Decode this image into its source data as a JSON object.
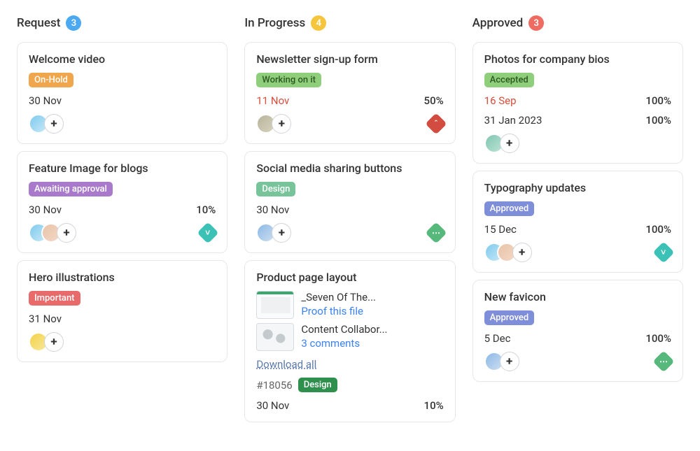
{
  "columns": [
    {
      "title": "Request",
      "count": "3",
      "badgeClass": "badge-blue",
      "cards": [
        {
          "title": "Welcome video",
          "tag": {
            "text": "On-Hold",
            "class": "tag-onhold"
          },
          "date": "30 Nov",
          "overdue": false,
          "progress": "",
          "assignees": [
            {
              "bg": "linear-gradient(135deg,#7ecaed,#c9e9f8)"
            }
          ],
          "priority": null
        },
        {
          "title": "Feature Image for blogs",
          "tag": {
            "text": "Awaiting approval",
            "class": "tag-awaiting"
          },
          "date": "30 Nov",
          "overdue": false,
          "progress": "10%",
          "assignees": [
            {
              "bg": "linear-gradient(135deg,#7ecaed,#c9e9f8)"
            },
            {
              "bg": "linear-gradient(135deg,#e9c3a8,#f3d8c6)"
            }
          ],
          "priority": {
            "class": "pri-teal",
            "glyph": "˅"
          }
        },
        {
          "title": "Hero illustrations",
          "tag": {
            "text": "Important",
            "class": "tag-important"
          },
          "date": "31 Nov",
          "overdue": false,
          "progress": "",
          "assignees": [
            {
              "bg": "linear-gradient(135deg,#f4d24a,#f8e79a)"
            }
          ],
          "priority": null
        }
      ]
    },
    {
      "title": "In Progress",
      "count": "4",
      "badgeClass": "badge-yellow",
      "cards": [
        {
          "title": "Newsletter sign-up form",
          "tag": {
            "text": "Working on it",
            "class": "tag-working"
          },
          "date": "11 Nov",
          "overdue": true,
          "progress": "50%",
          "assignees": [
            {
              "bg": "linear-gradient(135deg,#b8b49a,#d6d3bf)"
            }
          ],
          "priority": {
            "class": "pri-red",
            "glyph": "ˆ"
          }
        },
        {
          "title": "Social media sharing buttons",
          "tag": {
            "text": "Design",
            "class": "tag-design"
          },
          "date": "30 Nov",
          "overdue": false,
          "progress": "",
          "assignees": [
            {
              "bg": "linear-gradient(135deg,#8db8e6,#cddff1)"
            }
          ],
          "priority": {
            "class": "pri-green",
            "glyph": "⋯"
          }
        },
        {
          "title": "Product page layout",
          "attachments": [
            {
              "name": "_Seven Of The...",
              "action": "Proof this file",
              "thumbClass": "thumb"
            },
            {
              "name": "Content Collabor...",
              "action": "3 comments",
              "thumbClass": "thumb2"
            }
          ],
          "download": "Download all",
          "ref": "#18056",
          "refTag": {
            "text": "Design",
            "class": "tag-design-dark"
          },
          "date": "30 Nov",
          "overdue": false,
          "progress": "10%",
          "assignees": [],
          "priority": null
        }
      ]
    },
    {
      "title": "Approved",
      "count": "3",
      "badgeClass": "badge-red",
      "cards": [
        {
          "title": "Photos for company bios",
          "tag": {
            "text": "Accepted",
            "class": "tag-accepted"
          },
          "date": "16 Sep",
          "overdue": true,
          "date2": "31 Jan 2023",
          "progress": "100%",
          "assignees": [
            {
              "bg": "linear-gradient(135deg,#7fc6b0,#bde3d6)"
            }
          ],
          "priority": null
        },
        {
          "title": "Typography updates",
          "tag": {
            "text": "Approved",
            "class": "tag-approved"
          },
          "date": "15 Dec",
          "overdue": false,
          "progress": "100%",
          "assignees": [
            {
              "bg": "linear-gradient(135deg,#7ecaed,#c9e9f8)"
            },
            {
              "bg": "linear-gradient(135deg,#e9c3a8,#f3d8c6)"
            }
          ],
          "priority": {
            "class": "pri-teal",
            "glyph": "˅"
          }
        },
        {
          "title": "New favicon",
          "tag": {
            "text": "Approved",
            "class": "tag-approved"
          },
          "date": "5 Dec",
          "overdue": false,
          "progress": "100%",
          "assignees": [
            {
              "bg": "linear-gradient(135deg,#8db8e6,#cddff1)"
            }
          ],
          "priority": {
            "class": "pri-green2",
            "glyph": "⋯"
          }
        }
      ]
    }
  ],
  "ui": {
    "addAssigneeGlyph": "+"
  }
}
